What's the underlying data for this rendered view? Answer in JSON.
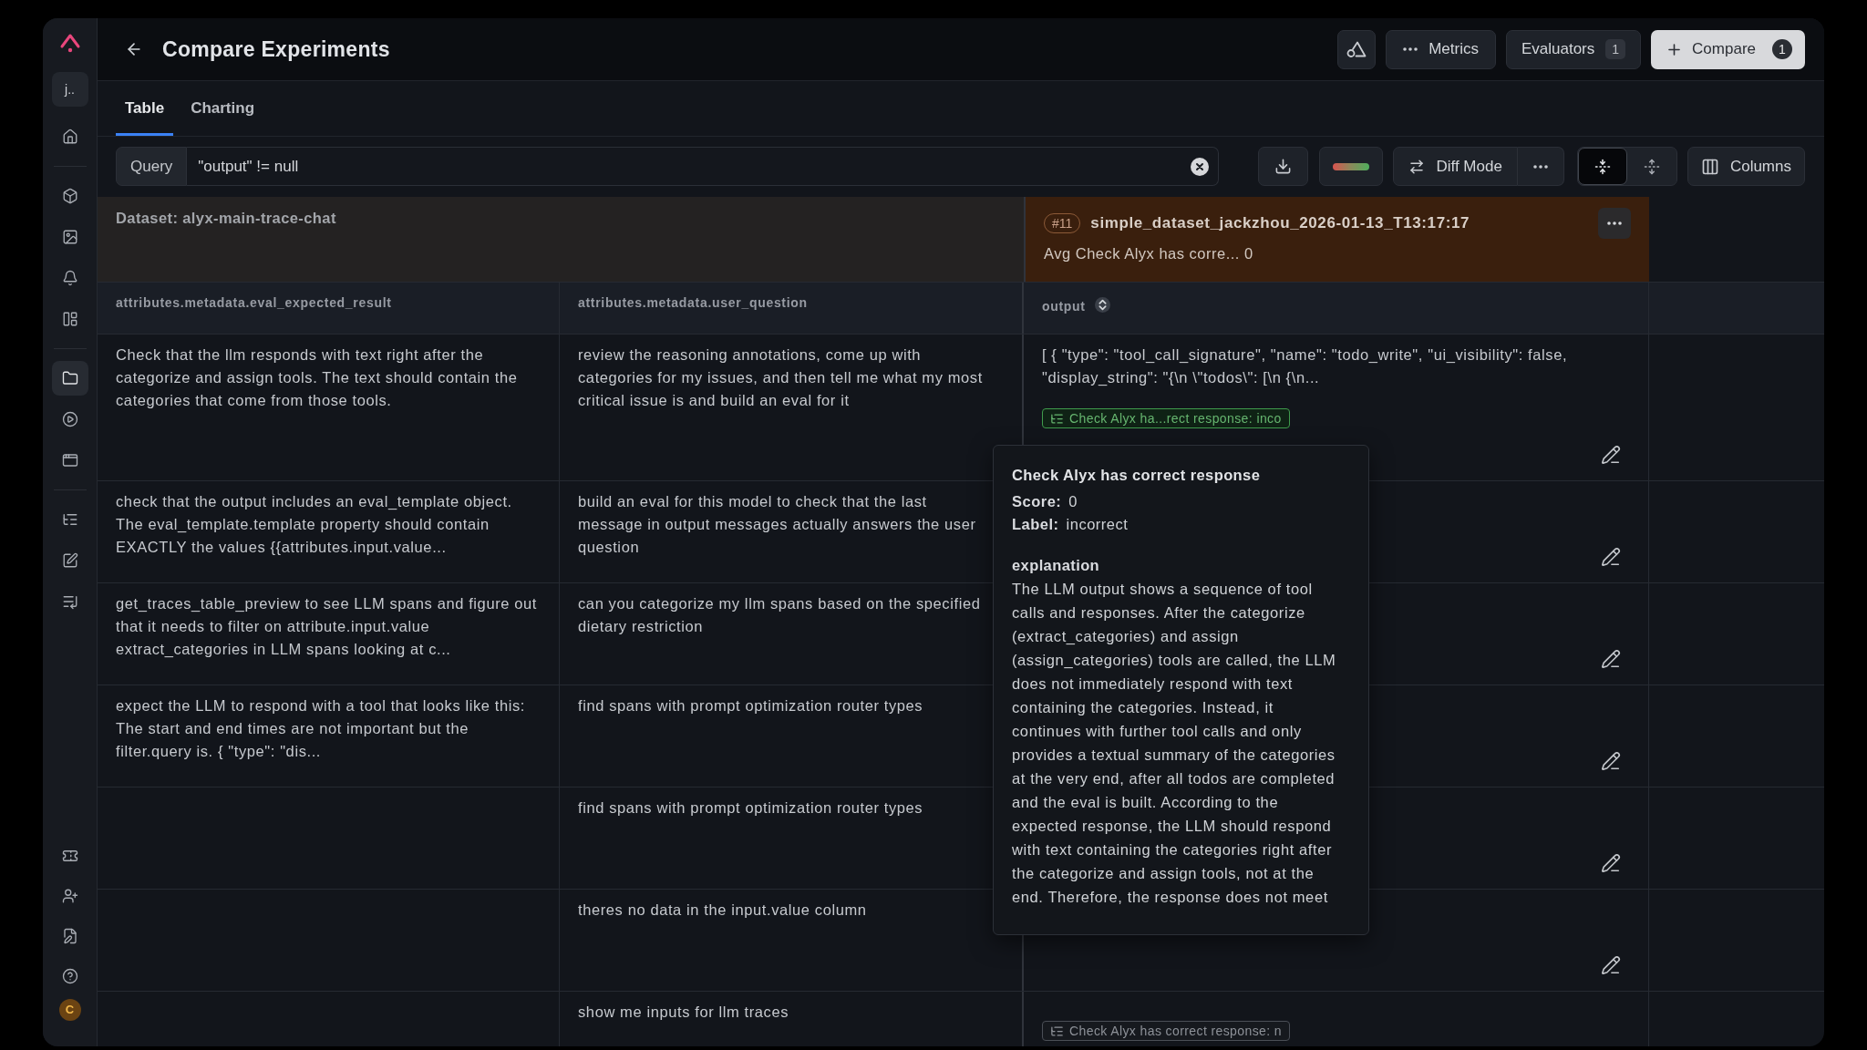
{
  "sidebar": {
    "workspace": "j..",
    "groups": [
      {
        "items": [
          {
            "selected": false
          }
        ]
      },
      {
        "items": [
          {
            "selected": false
          },
          {
            "selected": false
          },
          {
            "selected": false
          },
          {
            "selected": false
          }
        ]
      },
      {
        "items": [
          {
            "selected": true
          },
          {
            "selected": false
          },
          {
            "selected": false
          }
        ]
      },
      {
        "items": [
          {
            "selected": false
          },
          {
            "selected": false
          },
          {
            "selected": false
          }
        ]
      }
    ],
    "bottom_items": [
      {
        "selected": false
      },
      {
        "selected": false
      },
      {
        "selected": false
      },
      {
        "selected": false
      }
    ],
    "avatar": "C"
  },
  "header": {
    "title": "Compare Experiments",
    "metrics": "Metrics",
    "evaluators": {
      "label": "Evaluators",
      "count": "1"
    },
    "compare": {
      "label": "Compare",
      "count": "1"
    }
  },
  "tabs": [
    {
      "label": "Table",
      "selected": true
    },
    {
      "label": "Charting",
      "selected": false
    }
  ],
  "toolbar": {
    "query_label": "Query",
    "query_value": "\"output\" != null",
    "diff_mode": "Diff Mode",
    "row_density": [
      {
        "selected": true
      },
      {
        "selected": false
      }
    ],
    "columns": "Columns"
  },
  "table": {
    "dataset": "Dataset: alyx-main-trace-chat",
    "experiment": {
      "number": "#11",
      "name": "simple_dataset_jackzhou_2026-01-13_T13:17:17",
      "summary": "Avg Check Alyx has corre... 0"
    },
    "columns": [
      "attributes.metadata.eval_expected_result",
      "attributes.metadata.user_question",
      "output"
    ],
    "rows": [
      {
        "expected_result": "Check that the llm responds with text right after the categorize and assign tools. The text should contain the categories that come from those tools.",
        "user_question": "review the reasoning annotations, come up with categories for my issues, and then tell me what my most critical issue is and build an eval for it",
        "output": "[ { \"type\": \"tool_call_signature\", \"name\": \"todo_write\", \"ui_visibility\": false, \"display_string\": \"{\\n \\\"todos\\\": [\\n {\\n...",
        "annotation": {
          "label": "Check Alyx ha...rect response: inco",
          "active": true
        },
        "editable": true
      },
      {
        "expected_result": "check that the output includes an eval_template object. The eval_template.template property should contain EXACTLY the values {{attributes.input.value...",
        "user_question": "build an eval for this model to check that the last message in output messages actually answers the user question",
        "editable": true
      },
      {
        "expected_result": "get_traces_table_preview to see LLM spans and figure out that it needs to filter on attribute.input.value extract_categories in LLM spans looking at c...",
        "user_question": "can you categorize my llm spans based on the specified dietary restriction",
        "editable": true
      },
      {
        "expected_result": "expect the LLM to respond with a tool that looks like this: The start and end times are not important but the filter.query is. { \"type\": \"dis...",
        "user_question": "find spans with prompt optimization router types",
        "editable": true
      },
      {
        "user_question": "find spans with prompt optimization router types",
        "editable": true
      },
      {
        "user_question": "theres no data in the input.value column",
        "editable": true
      },
      {
        "user_question": "show me inputs for llm traces",
        "annotation": {
          "label": "Check Alyx has correct response: n",
          "active": false
        },
        "editable": false
      }
    ]
  },
  "tooltip": {
    "title": "Check Alyx has correct response",
    "fields": [
      {
        "name": "Score:",
        "value": "0"
      },
      {
        "name": "Label:",
        "value": "incorrect"
      }
    ],
    "heading": "explanation",
    "explanation": "The LLM output shows a sequence of tool calls and responses. After the categorize (extract_categories) and assign (assign_categories) tools are called, the LLM does not immediately respond with text containing the categories. Instead, it continues with further tool calls and only provides a textual summary of the categories at the very end, after all todos are completed and the eval is built. According to the expected response, the LLM should respond with text containing the categories right after the categorize and assign tools, not at the end. Therefore, the response does not meet"
  }
}
